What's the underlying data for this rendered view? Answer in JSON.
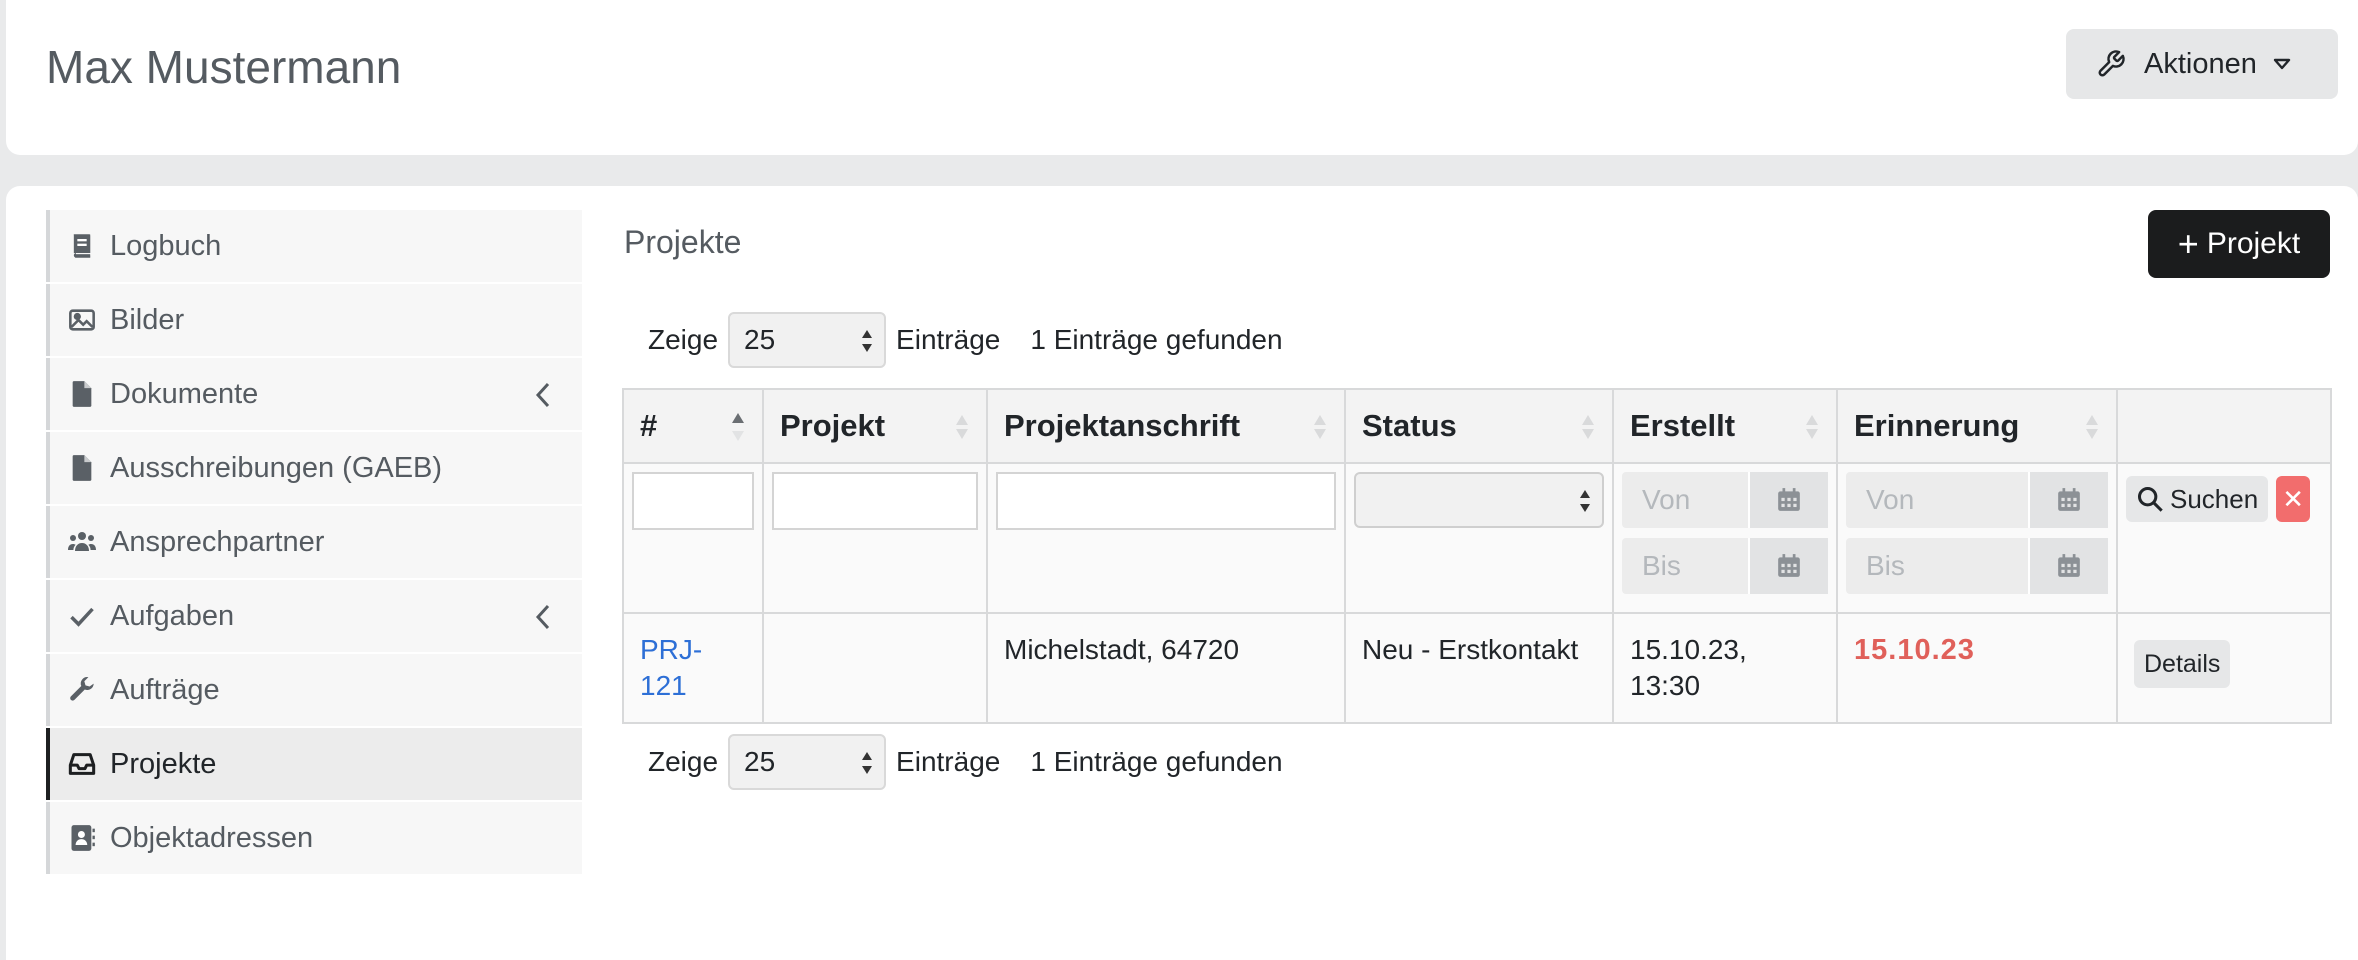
{
  "header": {
    "title": "Max Mustermann",
    "actions_label": "Aktionen"
  },
  "sidebar": {
    "items": [
      {
        "label": "Logbuch",
        "icon": "book-icon"
      },
      {
        "label": "Bilder",
        "icon": "image-icon"
      },
      {
        "label": "Dokumente",
        "icon": "file-icon",
        "expandable": true
      },
      {
        "label": "Ausschreibungen (GAEB)",
        "icon": "file-icon"
      },
      {
        "label": "Ansprechpartner",
        "icon": "users-icon"
      },
      {
        "label": "Aufgaben",
        "icon": "check-icon",
        "expandable": true
      },
      {
        "label": "Aufträge",
        "icon": "wrench-icon"
      },
      {
        "label": "Projekte",
        "icon": "inbox-icon",
        "active": true
      },
      {
        "label": "Objektadressen",
        "icon": "address-card-icon"
      }
    ]
  },
  "content": {
    "title": "Projekte",
    "add_button": "Projekt",
    "length": {
      "prefix": "Zeige",
      "value": "25",
      "suffix": "Einträge",
      "info": "1 Einträge gefunden"
    },
    "table": {
      "columns": [
        "#",
        "Projekt",
        "Projektanschrift",
        "Status",
        "Erstellt",
        "Erinnerung",
        ""
      ],
      "filters": {
        "from_placeholder": "Von",
        "to_placeholder": "Bis",
        "search_label": "Suchen"
      },
      "rows": [
        {
          "id": "PRJ-121",
          "id_line1": "PRJ-",
          "id_line2": "121",
          "projekt": "",
          "anschrift": "Michelstadt, 64720",
          "status": "Neu - Erstkontakt",
          "erstellt_date": "15.10.23,",
          "erstellt_time": "13:30",
          "erinnerung": "15.10.23",
          "action": "Details"
        }
      ]
    }
  },
  "colors": {
    "primary_button": "#1b1c1d",
    "link": "#2d6fd6",
    "reminder_overdue": "#e0605a",
    "clear_button": "#f26d6d"
  }
}
